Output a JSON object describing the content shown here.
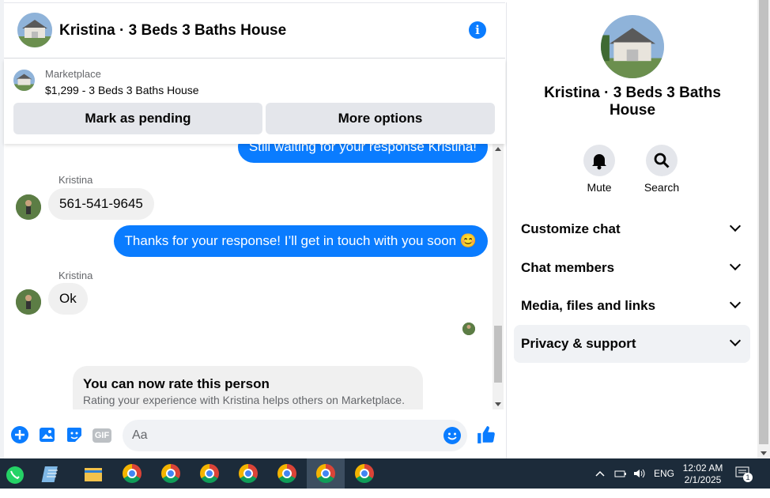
{
  "header": {
    "title": "Kristina · 3 Beds 3 Baths House"
  },
  "marketplace": {
    "label": "Marketplace",
    "item": "$1,299 - 3 Beds 3 Baths House",
    "pending_button": "Mark as pending",
    "more_button": "More options"
  },
  "messages": {
    "top_partial": "Still waiting for your response Kristina!",
    "sender1": "Kristina",
    "msg1": "561-541-9645",
    "out1": "Thanks for your response! I’ll get in touch with you soon 😊",
    "sender2": "Kristina",
    "msg2": "Ok",
    "rate_title": "You can now rate this person",
    "rate_sub": "Rating your experience with Kristina helps others on Marketplace."
  },
  "composer": {
    "placeholder": "Aa",
    "gif": "GIF"
  },
  "right_panel": {
    "name": "Kristina · 3 Beds 3 Baths House",
    "mute": "Mute",
    "search": "Search",
    "sections": [
      "Customize chat",
      "Chat members",
      "Media, files and links",
      "Privacy & support"
    ]
  },
  "taskbar": {
    "lang": "ENG",
    "time": "12:02 AM",
    "date": "2/1/2025",
    "notif": "1"
  },
  "colors": {
    "accent": "#0a7cff",
    "bubble_in": "#f0f0f0",
    "taskbar": "#1c2b3a"
  }
}
